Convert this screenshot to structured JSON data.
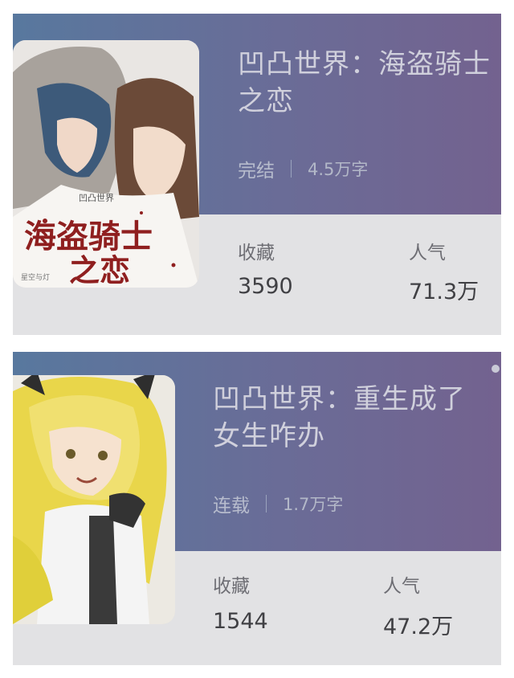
{
  "books": [
    {
      "title": "凹凸世界：海盗骑士之恋",
      "status": "完结",
      "word_count": "4.5万字",
      "favorites_label": "收藏",
      "favorites_value": "3590",
      "popularity_label": "人气",
      "popularity_value": "71.3万",
      "cover": {
        "series_tag": "凹凸世界",
        "title_line1": "海盗骑士",
        "title_line2": "之恋",
        "author_tag": "星空与灯"
      }
    },
    {
      "title": "凹凸世界：重生成了女生咋办",
      "status": "连载",
      "word_count": "1.7万字",
      "favorites_label": "收藏",
      "favorites_value": "1544",
      "popularity_label": "人气",
      "popularity_value": "47.2万"
    }
  ],
  "colors": {
    "band_start": "#58789e",
    "band_end": "#73628f",
    "card_bg": "#e2e2e4",
    "title_text": "#d0d0dc",
    "cover_title_red": "#8f1f1f"
  }
}
